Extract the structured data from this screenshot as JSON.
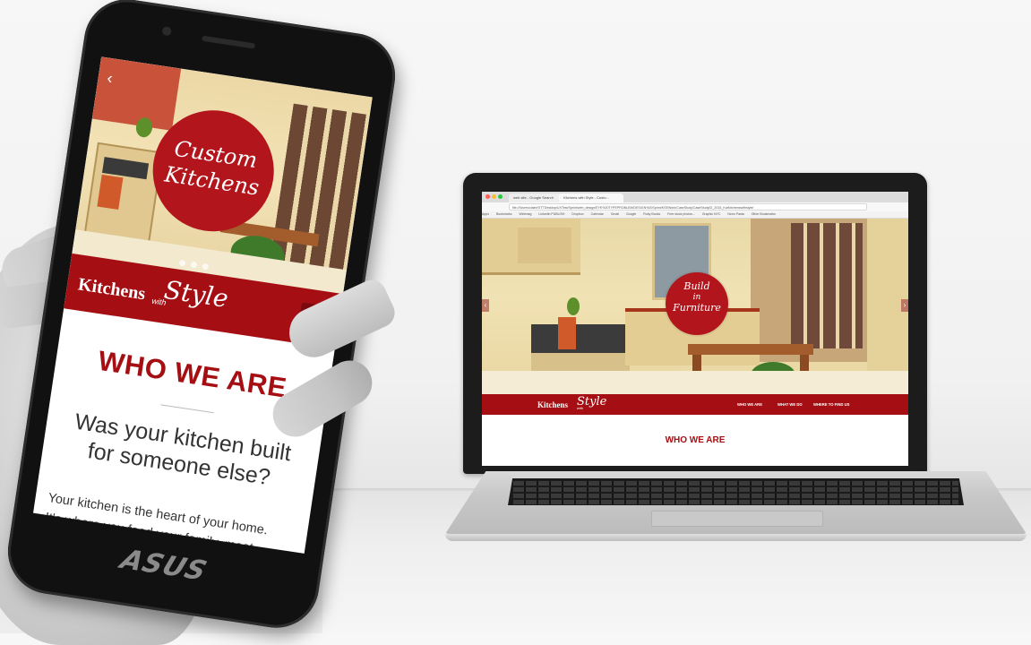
{
  "colors": {
    "brand_red": "#a50f13",
    "circle_red": "#b2161c",
    "hero_cream": "#f1e2b4"
  },
  "laptop": {
    "browser": {
      "tabs": [
        "web site - Google Search",
        "Kitchens with Style - Custo..."
      ],
      "url": "file:///Users/claire/GTTDesktop/UXTest/Sprint/web_design/EYE%20TYPEPROBLEM/DESIGN%20Sprint/KSEWork/CaseStudy/CaseStudy02_2015_Kw/kitchenswithstyle/",
      "bookmarks": [
        "Apps",
        "Bookmarks",
        "Webmag",
        "Linkedin PUBLISH",
        "Dropbox",
        "Calendar",
        "Gmail",
        "Google",
        "Ruby Books",
        "Free stock photos...",
        "Graphic NYC",
        "Neon Pasta",
        "Other Bookmarks"
      ]
    },
    "hero_circle": [
      "Build",
      "in",
      "Furniture"
    ],
    "logo": {
      "kitchens": "Kitchens",
      "style": "Style",
      "with": "with"
    },
    "menu": [
      "WHO WE ARE",
      "WHAT WE DO",
      "WHERE TO FIND US"
    ],
    "section_title": "WHO WE ARE"
  },
  "phone": {
    "hero_circle": [
      "Custom",
      "Kitchens"
    ],
    "logo": {
      "kitchens": "Kitchens",
      "style": "Style",
      "with": "with"
    },
    "menu_icon": "hamburger-icon",
    "section_title": "WHO WE ARE",
    "question": [
      "Was your kitchen built",
      "for someone else?"
    ],
    "body": [
      "Your kitchen is the heart of your home.",
      "It's where you feed your family, meet..."
    ],
    "brand": "ASUS",
    "nav_arrow": "chevron-left-icon"
  }
}
